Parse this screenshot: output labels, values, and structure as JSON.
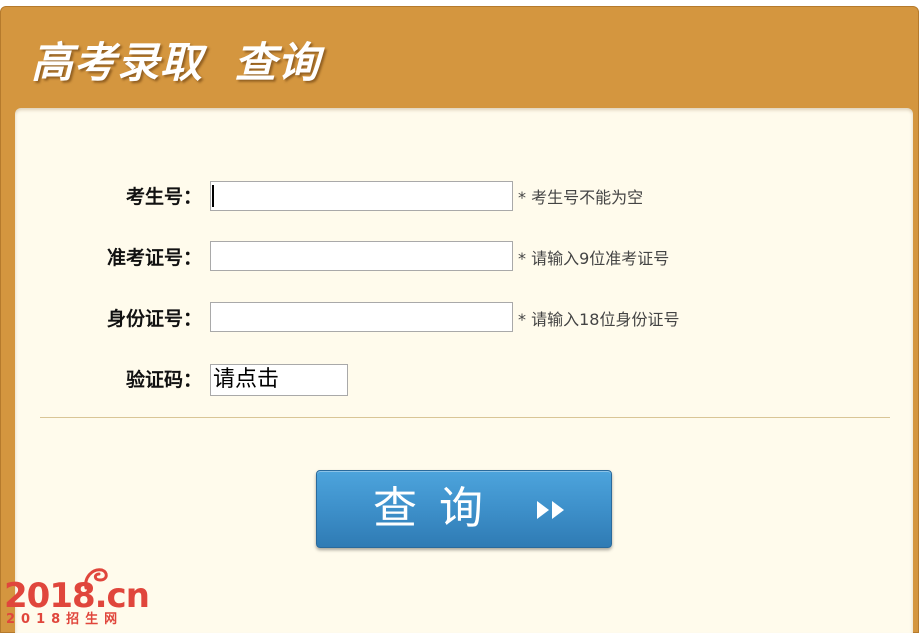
{
  "header": {
    "title": "高考录取  查询"
  },
  "form": {
    "exam_number": {
      "label": "考生号：",
      "value": "",
      "hint": "* 考生号不能为空"
    },
    "admission_ticket": {
      "label": "准考证号：",
      "value": "",
      "hint": "* 请输入9位准考证号"
    },
    "id_number": {
      "label": "身份证号：",
      "value": "",
      "hint": "* 请输入18位身份证号"
    },
    "captcha": {
      "label": "验证码：",
      "button_text": "请点击"
    }
  },
  "actions": {
    "query_label": "查询"
  },
  "branding": {
    "logo_main": "2018.cn",
    "logo_sub": "2018招生网"
  },
  "colors": {
    "frame": "#d4963f",
    "panel": "#fffbec",
    "button": "#3f92cc",
    "logo": "#e0463c"
  }
}
